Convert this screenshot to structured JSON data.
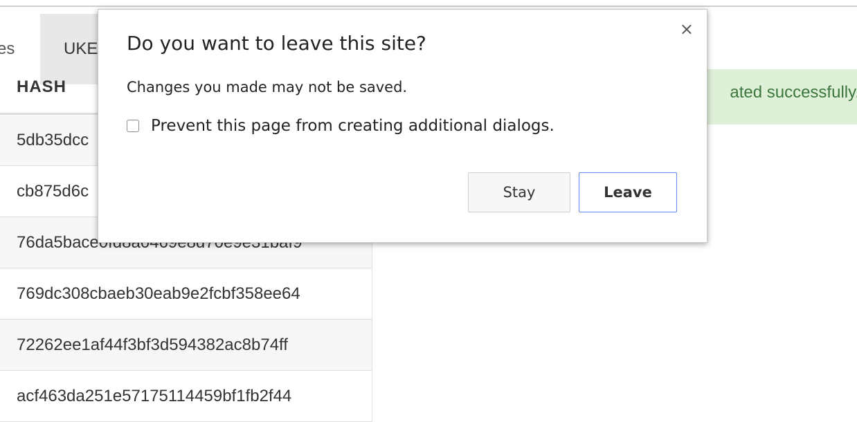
{
  "tabs": [
    {
      "label": "es"
    },
    {
      "label": "UKE"
    }
  ],
  "table": {
    "column_header": "HASH",
    "rows": [
      "5db35dcc",
      "cb875d6c",
      "76da5bace0fd8a0469e8d70e9e31baf9",
      "769dc308cbaeb30eab9e2fcbf358ee64",
      "72262ee1af44f3bf3d594382ac8b74ff",
      "acf463da251e57175114459bf1fb2f44"
    ]
  },
  "alert": {
    "text": "ated successfully."
  },
  "dialog": {
    "title": "Do you want to leave this site?",
    "message": "Changes you made may not be saved.",
    "checkbox_label": "Prevent this page from creating additional dialogs.",
    "close_symbol": "×",
    "stay_label": "Stay",
    "leave_label": "Leave"
  },
  "colors": {
    "success_bg": "#dff0d8",
    "success_text": "#3c763d",
    "leave_border": "#5b8dee"
  }
}
